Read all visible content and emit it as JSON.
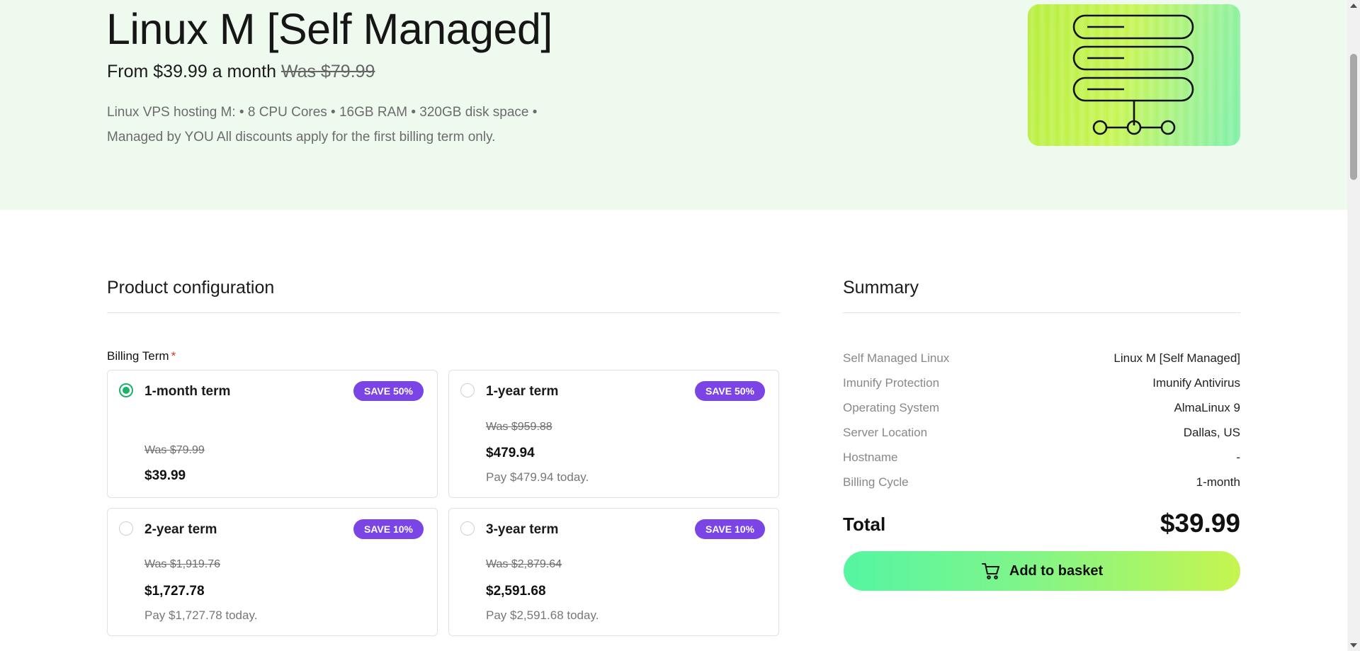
{
  "hero": {
    "title": "Linux M [Self Managed]",
    "price_prefix": "From $39.99 a month",
    "was_price": "Was $79.99",
    "description": "Linux VPS hosting M: • 8 CPU Cores • 16GB RAM • 320GB disk space • Managed by YOU All discounts apply for the first billing term only.",
    "image_icon": "server-network-icon"
  },
  "configuration": {
    "title": "Product configuration",
    "billing_label": "Billing Term",
    "required_mark": "*",
    "terms": [
      {
        "name": "1-month term",
        "badge": "SAVE 50%",
        "was": "Was $79.99",
        "price": "$39.99",
        "pay_today": "",
        "selected": true
      },
      {
        "name": "1-year term",
        "badge": "SAVE 50%",
        "was": "Was $959.88",
        "price": "$479.94",
        "pay_today": "Pay $479.94 today.",
        "selected": false
      },
      {
        "name": "2-year term",
        "badge": "SAVE 10%",
        "was": "Was $1,919.76",
        "price": "$1,727.78",
        "pay_today": "Pay $1,727.78 today.",
        "selected": false
      },
      {
        "name": "3-year term",
        "badge": "SAVE 10%",
        "was": "Was $2,879.64",
        "price": "$2,591.68",
        "pay_today": "Pay $2,591.68 today.",
        "selected": false
      }
    ]
  },
  "summary": {
    "title": "Summary",
    "rows": [
      {
        "label": "Self Managed Linux",
        "value": "Linux M [Self Managed]"
      },
      {
        "label": "Imunify Protection",
        "value": "Imunify Antivirus"
      },
      {
        "label": "Operating System",
        "value": "AlmaLinux 9"
      },
      {
        "label": "Server Location",
        "value": "Dallas, US"
      },
      {
        "label": "Hostname",
        "value": "-"
      },
      {
        "label": "Billing Cycle",
        "value": "1-month"
      }
    ],
    "total_label": "Total",
    "total_value": "$39.99",
    "add_button": "Add to basket",
    "add_button_icon": "cart-icon"
  },
  "colors": {
    "hero_bg": "#effaef",
    "badge": "#7b45e6",
    "radio_selected": "#19b26b",
    "button_gradient_start": "#55f5a3",
    "button_gradient_end": "#c6f54f"
  }
}
